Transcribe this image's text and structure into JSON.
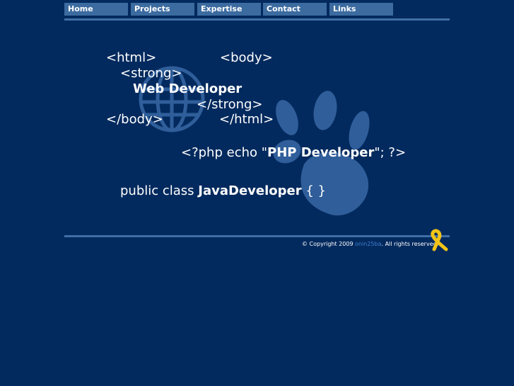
{
  "nav": {
    "items": [
      {
        "label": "Home"
      },
      {
        "label": "Projects"
      },
      {
        "label": "Expertise"
      },
      {
        "label": "Contact"
      },
      {
        "label": "Links"
      }
    ]
  },
  "hero": {
    "line_html_open": "<html>",
    "line_body_open": "<body>",
    "line_strong_open": "<strong>",
    "line_web_dev": "Web Developer",
    "line_strong_close": "</strong>",
    "line_body_close": "</body>",
    "line_html_close": "</html>",
    "php_prefix": "<?php echo \"",
    "php_bold": "PHP Developer",
    "php_suffix": "\"; ?>",
    "java_prefix": "public class ",
    "java_bold": "JavaDeveloper",
    "java_suffix": " { }"
  },
  "footer": {
    "copyright_prefix": "© Copyright 2009 ",
    "copyright_link": "onin25ba",
    "copyright_suffix": ". All rights reserved."
  },
  "colors": {
    "background": "#032a5e",
    "nav_button": "#3c6ba0",
    "rule": "#3f6fa6",
    "watermark": "#2f5e9a",
    "ribbon": "#f2c418"
  }
}
